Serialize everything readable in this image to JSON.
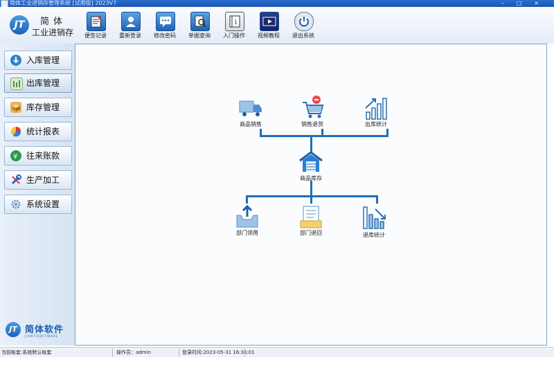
{
  "window": {
    "title": "简体工业进销存管理系统 [试用版] 2023V7"
  },
  "logo": {
    "mark": "JT",
    "line1": "简体",
    "line2": "工业进销存"
  },
  "toolbar": [
    {
      "label": "便签记录",
      "icon": "notepad-icon"
    },
    {
      "label": "重新登录",
      "icon": "user-icon"
    },
    {
      "label": "修改密码",
      "icon": "chat-bubble-icon"
    },
    {
      "label": "单据查询",
      "icon": "search-doc-icon"
    },
    {
      "label": "入门操作",
      "icon": "book-icon"
    },
    {
      "label": "视频教程",
      "icon": "video-icon"
    },
    {
      "label": "退出系统",
      "icon": "power-icon"
    }
  ],
  "sidebar": [
    {
      "label": "入库管理",
      "icon": "download-icon",
      "color": "#2a7fd4"
    },
    {
      "label": "出库管理",
      "icon": "bars-icon",
      "color": "#3f9a3a"
    },
    {
      "label": "库存管理",
      "icon": "box-icon",
      "color": "#d98f2a"
    },
    {
      "label": "统计报表",
      "icon": "pie-chart-icon",
      "color": "#d23c3c"
    },
    {
      "label": "往来账款",
      "icon": "money-icon",
      "color": "#2e9a4f"
    },
    {
      "label": "生产加工",
      "icon": "wrench-icon",
      "color": "#2a62c4"
    },
    {
      "label": "系统设置",
      "icon": "gear-icon",
      "color": "#5a8fc4"
    }
  ],
  "brand": {
    "mark": "JT",
    "name": "简体软件",
    "sub": "JIANTISOFTWARE"
  },
  "flow": {
    "top": [
      {
        "label": "商品销售",
        "icon": "truck-icon"
      },
      {
        "label": "销售退货",
        "icon": "cart-return-icon"
      },
      {
        "label": "出库统计",
        "icon": "chart-up-icon"
      }
    ],
    "center": {
      "label": "商品库存",
      "icon": "warehouse-icon"
    },
    "bottom": [
      {
        "label": "部门领用",
        "icon": "tray-upload-icon"
      },
      {
        "label": "部门退回",
        "icon": "clipboard-return-icon"
      },
      {
        "label": "退库统计",
        "icon": "chart-down-icon"
      }
    ]
  },
  "status": {
    "account": "当前帐套:系统默认帐套",
    "operator": "操作员：admin",
    "login_time": "登录时间:2023-05-31 16:36:01"
  },
  "colors": {
    "accent": "#1e6fb6",
    "flow_line": "#1e6fb6"
  }
}
